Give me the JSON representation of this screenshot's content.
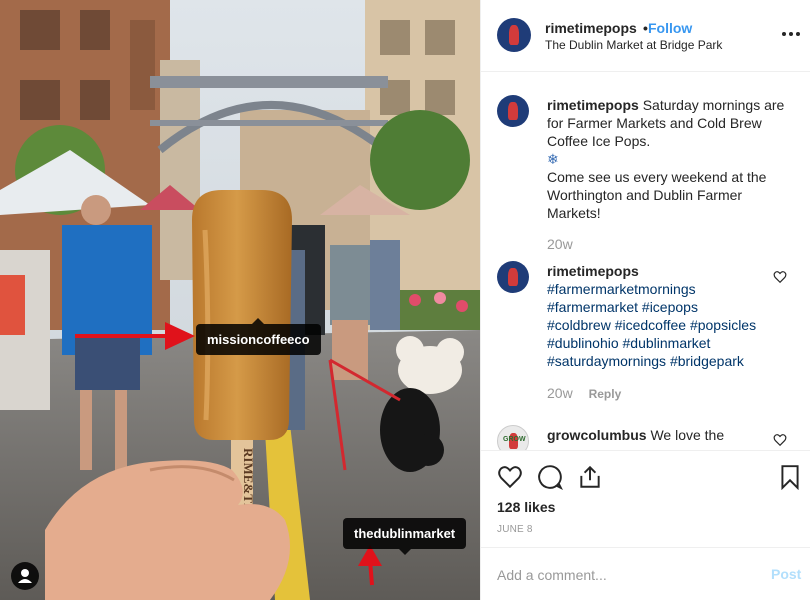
{
  "post": {
    "username": "rimetimepops",
    "separator": "•",
    "follow_label": "Follow",
    "location": "The Dublin Market at Bridge Park"
  },
  "photo": {
    "stick_text": "RIME&TIME",
    "tags": [
      "missioncoffeeco",
      "thedublinmarket"
    ]
  },
  "caption": {
    "username": "rimetimepops",
    "lines": [
      "Saturday mornings are",
      "for Farmer Markets and Cold Brew",
      "Coffee Ice Pops."
    ],
    "emoji": "❄",
    "lines2": [
      "Come see us every weekend at the",
      "Worthington and Dublin Farmer",
      "Markets!"
    ],
    "age": "20w"
  },
  "hashtag_comment": {
    "username": "rimetimepops",
    "lines": [
      "#farmermarketmornings",
      "#farmermarket #icepops",
      "#coldbrew #icedcoffee #popsicles",
      "#dublinohio #dublinmarket",
      "#saturdaymornings #bridgepark"
    ],
    "age": "20w",
    "reply_label": "Reply"
  },
  "third_comment": {
    "username": "growcolumbus",
    "text": "We love the",
    "avatar_text": "GROW"
  },
  "actions": {
    "icons": [
      "heart-icon",
      "comment-icon",
      "share-icon",
      "bookmark-icon"
    ],
    "likes": "128 likes",
    "date": "JUNE 8"
  },
  "comment_box": {
    "placeholder": "Add a comment...",
    "post_label": "Post"
  },
  "colors": {
    "link_blue": "#3897f0",
    "hashtag": "#003569",
    "muted": "#999999",
    "post_disabled": "#b2dffc",
    "arrow_red": "#e0121b"
  }
}
